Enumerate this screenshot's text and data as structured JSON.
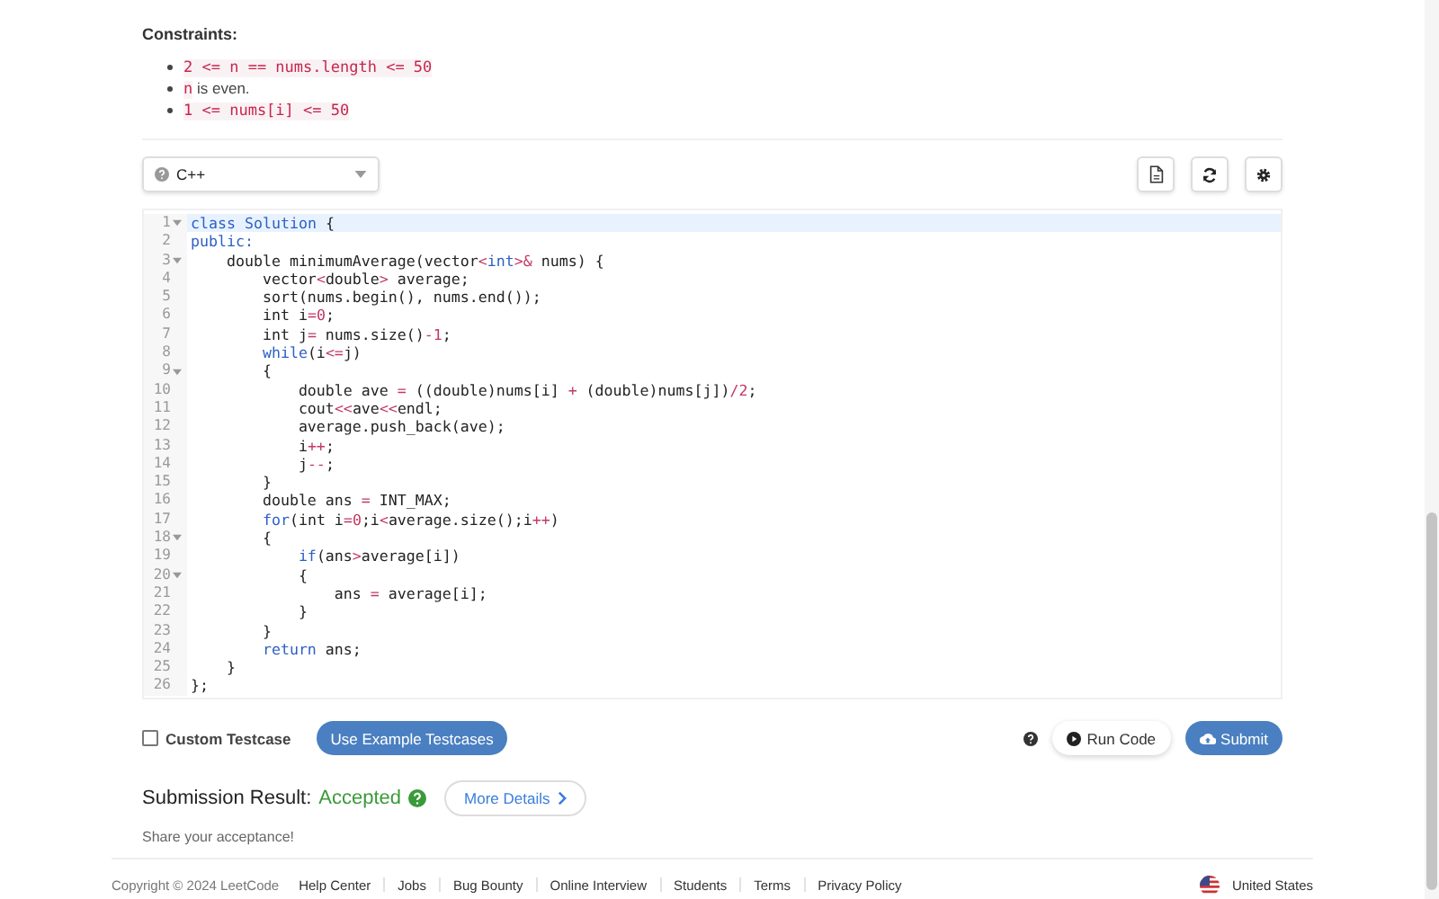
{
  "constraints": {
    "title": "Constraints:",
    "items": [
      {
        "parts": [
          {
            "kind": "code",
            "text": "2 <= n == nums.length <= 50"
          }
        ]
      },
      {
        "parts": [
          {
            "kind": "code",
            "text": "n"
          },
          {
            "kind": "text",
            "text": " is even."
          }
        ]
      },
      {
        "parts": [
          {
            "kind": "code",
            "text": "1 <= nums[i] <= 50"
          }
        ]
      }
    ]
  },
  "language_select": {
    "value": "C++"
  },
  "editor": {
    "lines": [
      {
        "number": "1",
        "foldable": true,
        "active": true,
        "tokens": [
          {
            "kind": "kw",
            "text": "class"
          },
          {
            "kind": "ty",
            "text": " Solution"
          },
          {
            "kind": "tx",
            "text": " {"
          }
        ]
      },
      {
        "number": "2",
        "foldable": false,
        "active": false,
        "tokens": [
          {
            "kind": "kw",
            "text": "public:"
          }
        ]
      },
      {
        "number": "3",
        "foldable": true,
        "active": false,
        "tokens": [
          {
            "kind": "tx",
            "text": "    double minimumAverage(vector"
          },
          {
            "kind": "op",
            "text": "<"
          },
          {
            "kind": "kw",
            "text": "int"
          },
          {
            "kind": "op",
            "text": ">&"
          },
          {
            "kind": "tx",
            "text": " nums) {"
          }
        ]
      },
      {
        "number": "4",
        "foldable": false,
        "active": false,
        "tokens": [
          {
            "kind": "tx",
            "text": "        vector"
          },
          {
            "kind": "op",
            "text": "<"
          },
          {
            "kind": "tx",
            "text": "double"
          },
          {
            "kind": "op",
            "text": ">"
          },
          {
            "kind": "tx",
            "text": " average;"
          }
        ]
      },
      {
        "number": "5",
        "foldable": false,
        "active": false,
        "tokens": [
          {
            "kind": "tx",
            "text": "        sort(nums.begin(), nums.end());"
          }
        ]
      },
      {
        "number": "6",
        "foldable": false,
        "active": false,
        "tokens": [
          {
            "kind": "tx",
            "text": "        int i"
          },
          {
            "kind": "op",
            "text": "="
          },
          {
            "kind": "num",
            "text": "0"
          },
          {
            "kind": "tx",
            "text": ";"
          }
        ]
      },
      {
        "number": "7",
        "foldable": false,
        "active": false,
        "tokens": [
          {
            "kind": "tx",
            "text": "        int j"
          },
          {
            "kind": "op",
            "text": "="
          },
          {
            "kind": "tx",
            "text": " nums.size()"
          },
          {
            "kind": "op",
            "text": "-"
          },
          {
            "kind": "num",
            "text": "1"
          },
          {
            "kind": "tx",
            "text": ";"
          }
        ]
      },
      {
        "number": "8",
        "foldable": false,
        "active": false,
        "tokens": [
          {
            "kind": "kw",
            "text": "        while"
          },
          {
            "kind": "tx",
            "text": "(i"
          },
          {
            "kind": "op",
            "text": "<="
          },
          {
            "kind": "tx",
            "text": "j)"
          }
        ]
      },
      {
        "number": "9",
        "foldable": true,
        "active": false,
        "tokens": [
          {
            "kind": "tx",
            "text": "        {"
          }
        ]
      },
      {
        "number": "10",
        "foldable": false,
        "active": false,
        "tokens": [
          {
            "kind": "tx",
            "text": "            double ave "
          },
          {
            "kind": "op",
            "text": "="
          },
          {
            "kind": "tx",
            "text": " ((double)nums[i] "
          },
          {
            "kind": "op",
            "text": "+"
          },
          {
            "kind": "tx",
            "text": " (double)nums[j])"
          },
          {
            "kind": "op",
            "text": "/"
          },
          {
            "kind": "num",
            "text": "2"
          },
          {
            "kind": "tx",
            "text": ";"
          }
        ]
      },
      {
        "number": "11",
        "foldable": false,
        "active": false,
        "tokens": [
          {
            "kind": "tx",
            "text": "            cout"
          },
          {
            "kind": "op",
            "text": "<<"
          },
          {
            "kind": "tx",
            "text": "ave"
          },
          {
            "kind": "op",
            "text": "<<"
          },
          {
            "kind": "tx",
            "text": "endl;"
          }
        ]
      },
      {
        "number": "12",
        "foldable": false,
        "active": false,
        "tokens": [
          {
            "kind": "tx",
            "text": "            average.push_back(ave);"
          }
        ]
      },
      {
        "number": "13",
        "foldable": false,
        "active": false,
        "tokens": [
          {
            "kind": "tx",
            "text": "            i"
          },
          {
            "kind": "op",
            "text": "++"
          },
          {
            "kind": "tx",
            "text": ";"
          }
        ]
      },
      {
        "number": "14",
        "foldable": false,
        "active": false,
        "tokens": [
          {
            "kind": "tx",
            "text": "            j"
          },
          {
            "kind": "op",
            "text": "--"
          },
          {
            "kind": "tx",
            "text": ";"
          }
        ]
      },
      {
        "number": "15",
        "foldable": false,
        "active": false,
        "tokens": [
          {
            "kind": "tx",
            "text": "        }"
          }
        ]
      },
      {
        "number": "16",
        "foldable": false,
        "active": false,
        "tokens": [
          {
            "kind": "tx",
            "text": "        double ans "
          },
          {
            "kind": "op",
            "text": "="
          },
          {
            "kind": "tx",
            "text": " INT_MAX;"
          }
        ]
      },
      {
        "number": "17",
        "foldable": false,
        "active": false,
        "tokens": [
          {
            "kind": "kw",
            "text": "        for"
          },
          {
            "kind": "tx",
            "text": "(int i"
          },
          {
            "kind": "op",
            "text": "="
          },
          {
            "kind": "num",
            "text": "0"
          },
          {
            "kind": "tx",
            "text": ";i"
          },
          {
            "kind": "op",
            "text": "<"
          },
          {
            "kind": "tx",
            "text": "average.size();i"
          },
          {
            "kind": "op",
            "text": "++"
          },
          {
            "kind": "tx",
            "text": ")"
          }
        ]
      },
      {
        "number": "18",
        "foldable": true,
        "active": false,
        "tokens": [
          {
            "kind": "tx",
            "text": "        {"
          }
        ]
      },
      {
        "number": "19",
        "foldable": false,
        "active": false,
        "tokens": [
          {
            "kind": "kw",
            "text": "            if"
          },
          {
            "kind": "tx",
            "text": "(ans"
          },
          {
            "kind": "op",
            "text": ">"
          },
          {
            "kind": "tx",
            "text": "average[i])"
          }
        ]
      },
      {
        "number": "20",
        "foldable": true,
        "active": false,
        "tokens": [
          {
            "kind": "tx",
            "text": "            {"
          }
        ]
      },
      {
        "number": "21",
        "foldable": false,
        "active": false,
        "tokens": [
          {
            "kind": "tx",
            "text": "                ans "
          },
          {
            "kind": "op",
            "text": "="
          },
          {
            "kind": "tx",
            "text": " average[i];"
          }
        ]
      },
      {
        "number": "22",
        "foldable": false,
        "active": false,
        "tokens": [
          {
            "kind": "tx",
            "text": "            }"
          }
        ]
      },
      {
        "number": "23",
        "foldable": false,
        "active": false,
        "tokens": [
          {
            "kind": "tx",
            "text": "        }"
          }
        ]
      },
      {
        "number": "24",
        "foldable": false,
        "active": false,
        "tokens": [
          {
            "kind": "kw",
            "text": "        return"
          },
          {
            "kind": "tx",
            "text": " ans;"
          }
        ]
      },
      {
        "number": "25",
        "foldable": false,
        "active": false,
        "tokens": [
          {
            "kind": "tx",
            "text": "    }"
          }
        ]
      },
      {
        "number": "26",
        "foldable": false,
        "active": false,
        "tokens": [
          {
            "kind": "tx",
            "text": "};"
          }
        ]
      }
    ]
  },
  "custom_testcase": {
    "label": "Custom Testcase",
    "checked": false
  },
  "example_button": "Use Example Testcases",
  "run_button": "Run Code",
  "submit_button": "Submit",
  "result": {
    "label": "Submission Result:",
    "status": "Accepted",
    "details_button": "More Details"
  },
  "share_text": "Share your acceptance!",
  "footer": {
    "copyright": "Copyright © 2024 LeetCode",
    "links": [
      "Help Center",
      "Jobs",
      "Bug Bounty",
      "Online Interview",
      "Students",
      "Terms",
      "Privacy Policy"
    ],
    "region": "United States"
  }
}
